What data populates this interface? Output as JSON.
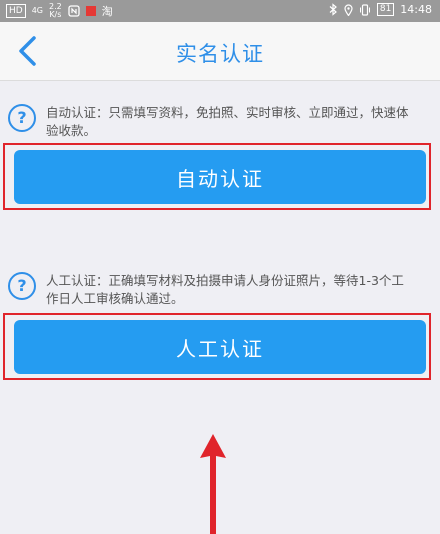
{
  "status_bar": {
    "left_hd": "HD",
    "network": "4G",
    "speed_value": "2.2",
    "speed_unit": "K/s",
    "app_label": "淘",
    "battery": "81",
    "time": "14:48"
  },
  "header": {
    "back_icon": "chevron-left-icon",
    "title": "实名认证"
  },
  "auto_section": {
    "help_icon": "question-circle-icon",
    "description": "自动认证：只需填写资料，免拍照、实时审核、立即通过，快速体\n验收款。",
    "button_label": "自动认证"
  },
  "manual_section": {
    "help_icon": "question-circle-icon",
    "description": "人工认证：正确填写材料及拍摄申请人身份证照片，等待1-3个工\n作日人工审核确认通过。",
    "button_label": "人工认证"
  },
  "colors": {
    "accent": "#2f8fe8",
    "button": "#259cf1",
    "highlight": "#e0242b"
  }
}
